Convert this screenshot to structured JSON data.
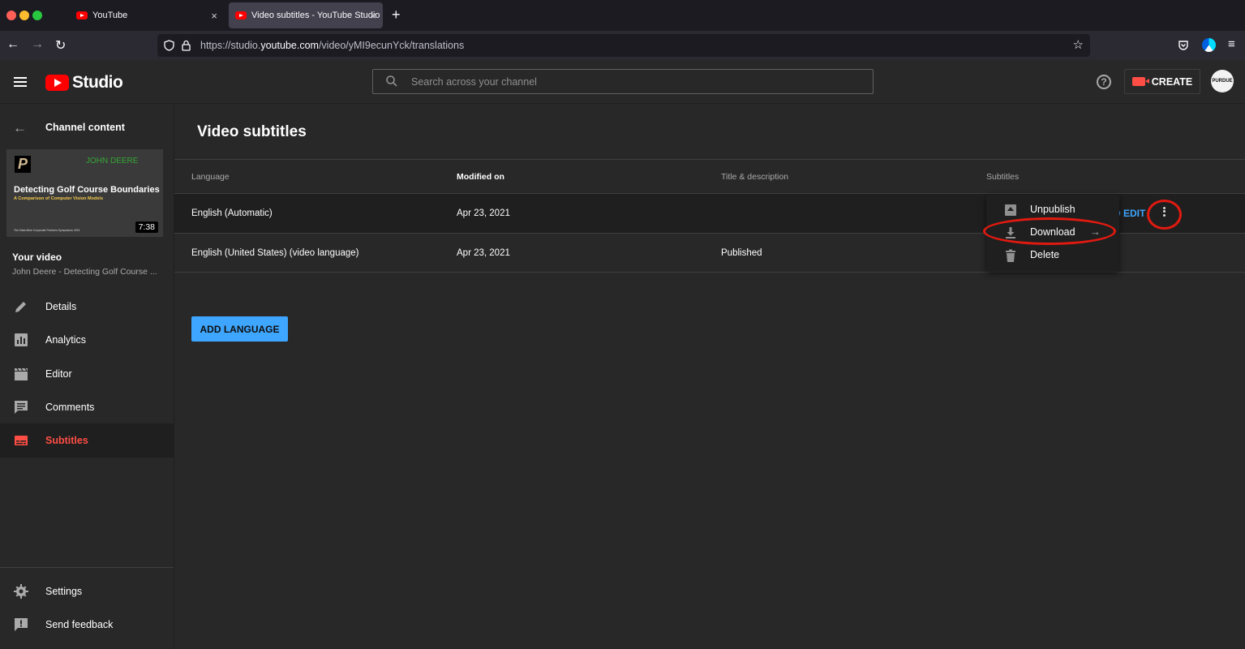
{
  "browser": {
    "tabs": [
      {
        "title": "YouTube",
        "close_icon": "×"
      },
      {
        "title": "Video subtitles - YouTube Studio",
        "close_icon": "×"
      }
    ],
    "new_tab": "+",
    "url_prefix": "https://studio.",
    "url_host": "youtube.com",
    "url_path": "/video/yMI9ecunYck/translations"
  },
  "header": {
    "logo_text": "Studio",
    "search_placeholder": "Search across your channel",
    "help_label": "?",
    "create_label": "CREATE",
    "avatar_text": "PURDUE"
  },
  "sidebar": {
    "title": "Channel content",
    "thumbnail": {
      "logo_letter": "P",
      "brand": "JOHN DEERE",
      "title": "Detecting Golf Course Boundaries",
      "subtitle": "A Comparison of Computer Vision Models",
      "footer": "The Data Mine Corporate Partners Symposium 2021",
      "duration": "7:38"
    },
    "your_video_label": "Your video",
    "video_name": "John Deere - Detecting Golf Course ...",
    "items": [
      {
        "label": "Details",
        "icon": "pencil-icon"
      },
      {
        "label": "Analytics",
        "icon": "analytics-icon"
      },
      {
        "label": "Editor",
        "icon": "clapperboard-icon"
      },
      {
        "label": "Comments",
        "icon": "comment-icon"
      },
      {
        "label": "Subtitles",
        "icon": "subtitles-icon",
        "active": true
      }
    ],
    "bottom_items": [
      {
        "label": "Settings",
        "icon": "gear-icon"
      },
      {
        "label": "Send feedback",
        "icon": "feedback-icon"
      }
    ]
  },
  "main": {
    "title": "Video subtitles",
    "columns": [
      "Language",
      "Modified on",
      "Title & description",
      "Subtitles"
    ],
    "rows": [
      {
        "language": "English (Automatic)",
        "modified": "Apr 23, 2021",
        "title_desc": "",
        "subtitles_action": "D EDIT"
      },
      {
        "language": "English (United States) (video language)",
        "modified": "Apr 23, 2021",
        "title_desc": "Published",
        "subtitles_action": ""
      }
    ],
    "add_language_label": "ADD LANGUAGE"
  },
  "menu": {
    "items": [
      {
        "label": "Unpublish",
        "icon": "unpublish-icon"
      },
      {
        "label": "Download",
        "icon": "download-icon",
        "has_submenu": true
      },
      {
        "label": "Delete",
        "icon": "trash-icon"
      }
    ]
  },
  "colors": {
    "accent_blue": "#3ea6ff",
    "brand_red": "#ff0000",
    "active_red": "#ff4e45",
    "annotation_red": "#e11a10"
  }
}
